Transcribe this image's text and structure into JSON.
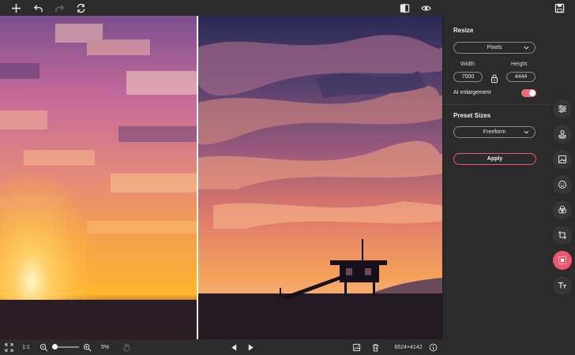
{
  "toolbar": {
    "icons": [
      "add-icon",
      "undo-icon",
      "redo-icon",
      "reset-icon",
      "compare-icon",
      "preview-eye-icon",
      "save-icon"
    ]
  },
  "panel": {
    "resize_title": "Resize",
    "unit_select": "Pixels",
    "width_label": "Width",
    "height_label": "Height",
    "width_value": "7000",
    "height_value": "4444",
    "ai_label": "AI enlargement",
    "ai_enabled": true,
    "preset_title": "Preset Sizes",
    "preset_select": "Freeform",
    "apply_label": "Apply"
  },
  "rail": {
    "tools": [
      "adjust-sliders-icon",
      "stamp-icon",
      "image-frame-icon",
      "emoji-icon",
      "color-filters-icon",
      "crop-icon",
      "resize-icon",
      "text-icon"
    ],
    "active": "resize-icon"
  },
  "bottom": {
    "ratio_label": "1:1",
    "zoom_percent": "5%",
    "zoom_level": 0.05,
    "dimensions": "6524×4142"
  },
  "colors": {
    "accent": "#f0566b",
    "background": "#2b2b2b"
  }
}
